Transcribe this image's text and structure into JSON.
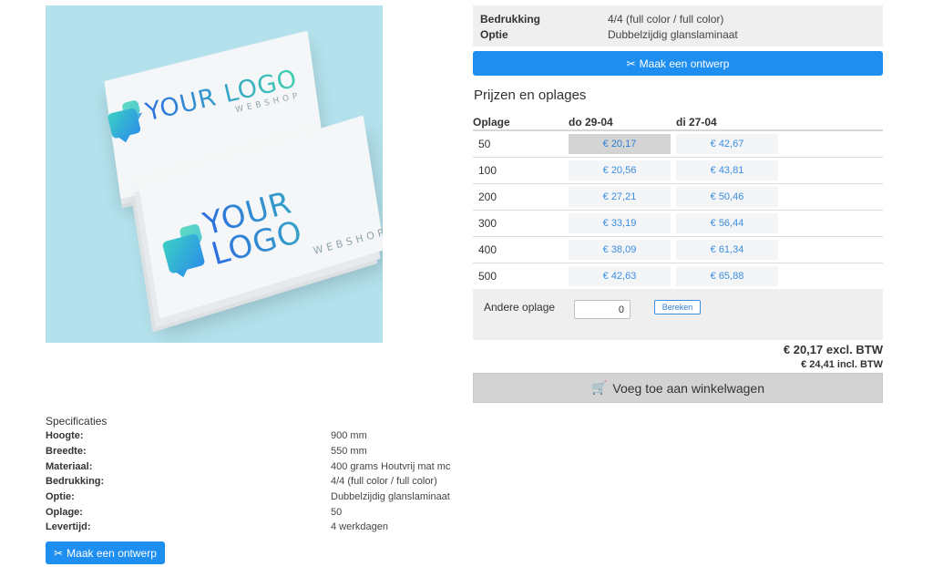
{
  "product_image": {
    "logo_word": "YOUR LOGO",
    "logo_sub": "WEBSHOP",
    "background_color": "#b3e1ec"
  },
  "options": [
    {
      "label": "Bedrukking",
      "value": "4/4 (full color / full color)"
    },
    {
      "label": "Optie",
      "value": "Dubbelzijdig glanslaminaat"
    }
  ],
  "design_button": {
    "label": "Maak een ontwerp",
    "icon": "scissors-icon"
  },
  "prices": {
    "title": "Prijzen en oplages",
    "headers": [
      "Oplage",
      "do 29-04",
      "di 27-04"
    ],
    "rows": [
      {
        "qty": "50",
        "p1": "€ 20,17",
        "p2": "€ 42,67"
      },
      {
        "qty": "100",
        "p1": "€ 20,56",
        "p2": "€ 43,81"
      },
      {
        "qty": "200",
        "p1": "€ 27,21",
        "p2": "€ 50,46"
      },
      {
        "qty": "300",
        "p1": "€ 33,19",
        "p2": "€ 56,44"
      },
      {
        "qty": "400",
        "p1": "€ 38,09",
        "p2": "€ 61,34"
      },
      {
        "qty": "500",
        "p1": "€ 42,63",
        "p2": "€ 65,88"
      }
    ],
    "selected": "€ 20,17"
  },
  "other_quantity": {
    "label": "Andere oplage",
    "value": "0",
    "button": "Bereken"
  },
  "totals": {
    "excl": "€ 20,17 excl. BTW",
    "incl": "€ 24,41 incl. BTW"
  },
  "cart_button": {
    "label": "Voeg toe aan winkelwagen",
    "icon": "cart-icon"
  },
  "specifications": {
    "title": "Specificaties",
    "rows": [
      {
        "label": "Hoogte:",
        "value": "900 mm"
      },
      {
        "label": "Breedte:",
        "value": "550 mm"
      },
      {
        "label": "Materiaal:",
        "value": "400 grams Houtvrij mat mc"
      },
      {
        "label": "Bedrukking:",
        "value": "4/4 (full color / full color)"
      },
      {
        "label": "Optie:",
        "value": "Dubbelzijdig glanslaminaat"
      },
      {
        "label": "Oplage:",
        "value": "50"
      },
      {
        "label": "Levertijd:",
        "value": "4 werkdagen"
      }
    ]
  },
  "colors": {
    "accent_blue": "#1e8ef0",
    "price_link": "#3c8ee0",
    "panel_gray": "#efefef"
  }
}
